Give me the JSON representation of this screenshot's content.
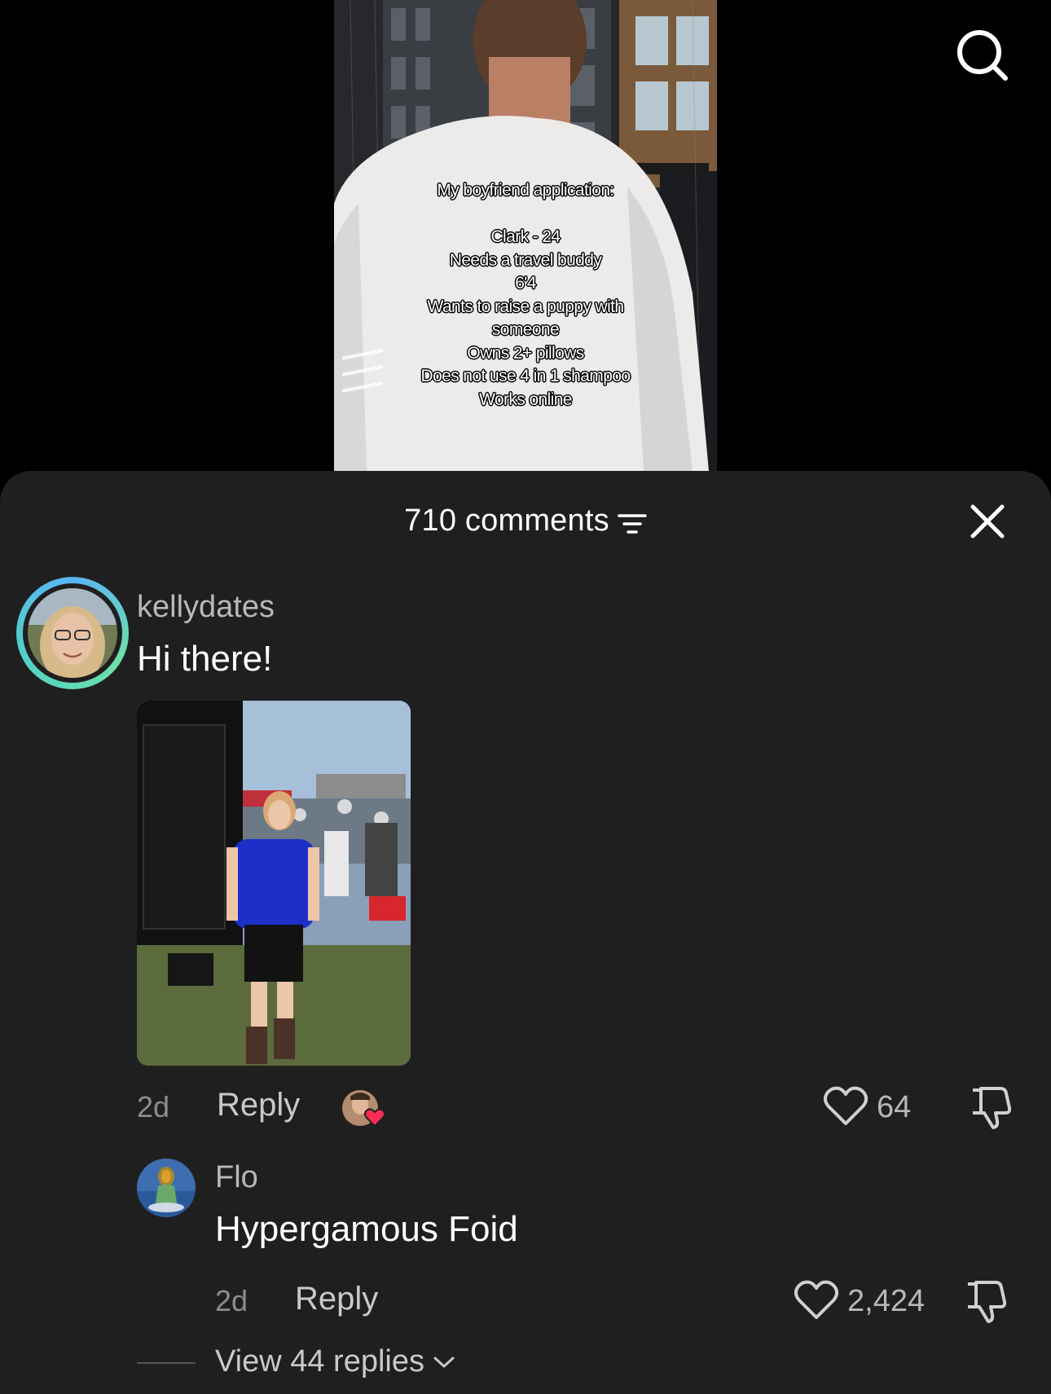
{
  "video": {
    "overlay_title": "My boyfriend application:",
    "overlay_lines": [
      "Clark - 24",
      "Needs a travel buddy",
      "6'4",
      "Wants to raise a puppy with",
      "someone",
      "Owns 2+ pillows",
      "Does not use 4 in 1 shampoo",
      "Works online"
    ]
  },
  "header": {
    "title": "710 comments"
  },
  "comments": [
    {
      "username": "kellydates",
      "text": "Hi there!",
      "age": "2d",
      "reply_label": "Reply",
      "likes": "64",
      "has_image": true,
      "liked_by_creator": true
    },
    {
      "username": "Flo",
      "text": "Hypergamous Foid",
      "age": "2d",
      "reply_label": "Reply",
      "likes": "2,424",
      "view_replies_label": "View 44 replies"
    }
  ],
  "icons": {
    "search": "search-icon",
    "filter": "filter-icon",
    "close": "close-icon",
    "like": "heart-outline-icon",
    "dislike": "thumbs-down-icon",
    "expand": "chevron-down-icon"
  },
  "colors": {
    "sheet_background": "#1f1f20",
    "username": "#b8b8b8",
    "meta": "#8c8c8c",
    "avatar_ring_start": "#5ab3f5",
    "avatar_ring_end": "#6ee0a8",
    "liked_heart": "#fe2c55"
  }
}
